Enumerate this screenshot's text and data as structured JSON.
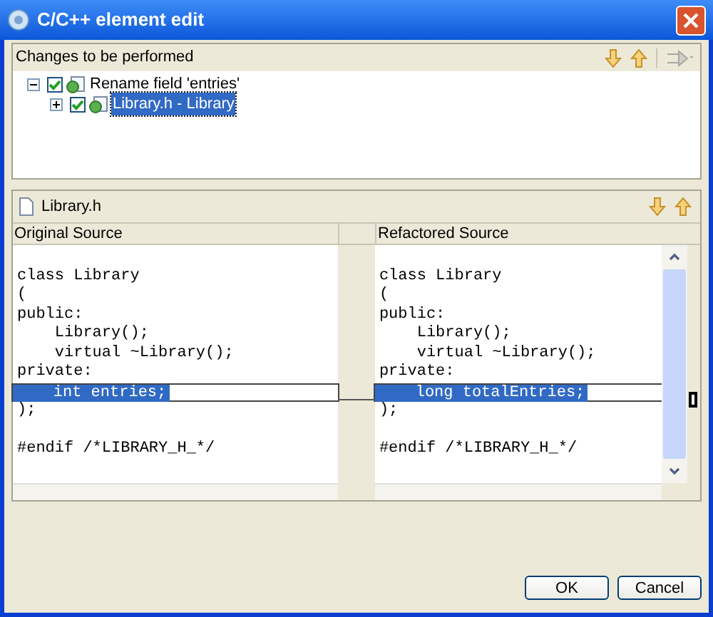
{
  "window": {
    "title": "C/C++ element edit"
  },
  "changes_panel": {
    "title": "Changes to be performed",
    "tree": [
      {
        "label": "Rename field 'entries'",
        "checked": true,
        "expanded": true,
        "selected": false,
        "children": [
          {
            "label": "Library.h - Library",
            "checked": true,
            "expanded": false,
            "selected": true
          }
        ]
      }
    ]
  },
  "compare_panel": {
    "file": "Library.h",
    "left_title": "Original Source",
    "right_title": "Refactored Source",
    "left_lines": [
      {
        "kind": "blank"
      },
      {
        "text": "class Library",
        "kind": "plain"
      },
      {
        "text": "(",
        "kind": "plain"
      },
      {
        "text": "public:",
        "kind": "plain"
      },
      {
        "text": "    Library();",
        "kind": "plain"
      },
      {
        "text": "    virtual ~Library();",
        "kind": "plain"
      },
      {
        "text": "private:",
        "kind": "plain"
      },
      {
        "text": "    int entries;",
        "kind": "changed"
      },
      {
        "text": ");",
        "kind": "plain"
      },
      {
        "kind": "blank"
      },
      {
        "text": "#endif /*LIBRARY_H_*/",
        "kind": "plain"
      }
    ],
    "right_lines": [
      {
        "kind": "blank"
      },
      {
        "text": "class Library",
        "kind": "plain"
      },
      {
        "text": "(",
        "kind": "plain"
      },
      {
        "text": "public:",
        "kind": "plain"
      },
      {
        "text": "    Library();",
        "kind": "plain"
      },
      {
        "text": "    virtual ~Library();",
        "kind": "plain"
      },
      {
        "text": "private:",
        "kind": "plain"
      },
      {
        "text": "    long totalEntries;",
        "kind": "changed"
      },
      {
        "text": ");",
        "kind": "plain"
      },
      {
        "kind": "blank"
      },
      {
        "text": "#endif /*LIBRARY_H_*/",
        "kind": "plain"
      }
    ]
  },
  "buttons": [
    {
      "label": "OK"
    },
    {
      "label": "Cancel"
    }
  ]
}
